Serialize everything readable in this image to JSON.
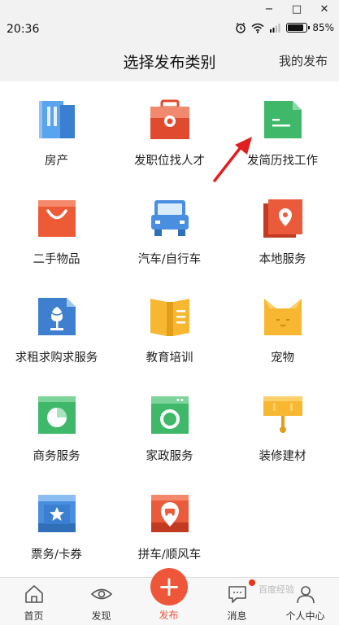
{
  "window_controls": {
    "minimize": "−",
    "maximize": "□",
    "close": "✕"
  },
  "status_bar": {
    "time": "20:36",
    "battery": "85%"
  },
  "header": {
    "title": "选择发布类别",
    "my_post": "我的发布"
  },
  "categories": [
    {
      "label": "房产",
      "icon": "building-icon",
      "color": "#4a90e2"
    },
    {
      "label": "发职位找人才",
      "icon": "briefcase-icon",
      "color": "#ea5b3c"
    },
    {
      "label": "发简历找工作",
      "icon": "resume-icon",
      "color": "#3fb86a"
    },
    {
      "label": "二手物品",
      "icon": "shopping-bag-icon",
      "color": "#ec5a36"
    },
    {
      "label": "汽车/自行车",
      "icon": "car-icon",
      "color": "#4a8ee0"
    },
    {
      "label": "本地服务",
      "icon": "location-pin-icon",
      "color": "#ea5b3c"
    },
    {
      "label": "求租求购求服务",
      "icon": "tulip-icon",
      "color": "#3f7fd0"
    },
    {
      "label": "教育培训",
      "icon": "open-book-icon",
      "color": "#f7b731"
    },
    {
      "label": "宠物",
      "icon": "cat-icon",
      "color": "#f7b731"
    },
    {
      "label": "商务服务",
      "icon": "pie-chart-icon",
      "color": "#3fb86a"
    },
    {
      "label": "家政服务",
      "icon": "washing-machine-icon",
      "color": "#3fb86a"
    },
    {
      "label": "装修建材",
      "icon": "paint-roller-icon",
      "color": "#f7b731"
    },
    {
      "label": "票务/卡券",
      "icon": "ticket-star-icon",
      "color": "#4a8ee0"
    },
    {
      "label": "拼车/顺风车",
      "icon": "carpool-pin-icon",
      "color": "#ea5b3c"
    }
  ],
  "tabbar": {
    "home": "首页",
    "discover": "发现",
    "publish": "发布",
    "messages": "消息",
    "profile": "个人中心"
  },
  "publish_icon": "+",
  "watermark": "百度经验",
  "colors": {
    "accent": "#ee5639",
    "header_bg": "#f2f2f2"
  }
}
